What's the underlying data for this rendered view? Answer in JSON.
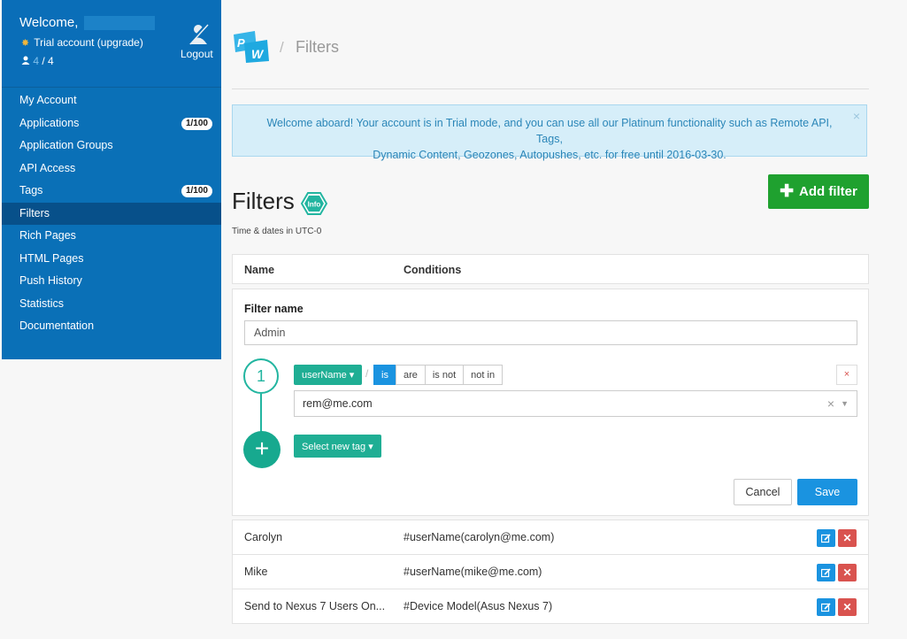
{
  "sidebar": {
    "welcome": "Welcome,",
    "trial": "Trial account (upgrade)",
    "users": {
      "current": "4",
      "total": "/ 4"
    },
    "logout": "Logout",
    "items": [
      {
        "label": "My Account"
      },
      {
        "label": "Applications",
        "badge": "1/100"
      },
      {
        "label": "Application Groups"
      },
      {
        "label": "API Access"
      },
      {
        "label": "Tags",
        "badge": "1/100"
      },
      {
        "label": "Filters",
        "active": true
      },
      {
        "label": "Rich Pages"
      },
      {
        "label": "HTML Pages"
      },
      {
        "label": "Push History"
      },
      {
        "label": "Statistics"
      },
      {
        "label": "Documentation"
      }
    ]
  },
  "header": {
    "logo_text": "PW",
    "breadcrumb_sep": "/",
    "breadcrumb": "Filters"
  },
  "alert": {
    "line1": "Welcome aboard! Your account is in Trial mode, and you can use all our Platinum functionality such as Remote API, Tags,",
    "line2": "Dynamic Content, Geozones, Autopushes, etc. for free until 2016-03-30.",
    "close": "×"
  },
  "page": {
    "title": "Filters",
    "info_icon_text": "Info",
    "add_filter": "Add filter",
    "timezone_note": "Time & dates in UTC-0"
  },
  "table": {
    "col_name": "Name",
    "col_conditions": "Conditions"
  },
  "editor": {
    "filter_name_label": "Filter name",
    "filter_name_value": "Admin",
    "step_number": "1",
    "tag_button": "userName ▾",
    "slash": "/",
    "operators": [
      "is",
      "are",
      "is not",
      "not in"
    ],
    "active_operator": "is",
    "remove_condition": "×",
    "value": "rem@me.com",
    "select_new_tag": "Select new tag ▾",
    "cancel": "Cancel",
    "save": "Save"
  },
  "filters": [
    {
      "name": "Carolyn",
      "conditions": "#userName(carolyn@me.com)"
    },
    {
      "name": "Mike",
      "conditions": "#userName(mike@me.com)"
    },
    {
      "name": "Send to Nexus 7 Users On...",
      "conditions": "#Device Model(Asus Nexus 7)"
    }
  ],
  "colors": {
    "sidebar": "#0a70b7",
    "sidebar_active": "#07508a",
    "primary": "#1a93e0",
    "success": "#1fa12f",
    "teal": "#1fae94",
    "danger": "#d9534f",
    "alert_bg": "#d6eef9"
  }
}
